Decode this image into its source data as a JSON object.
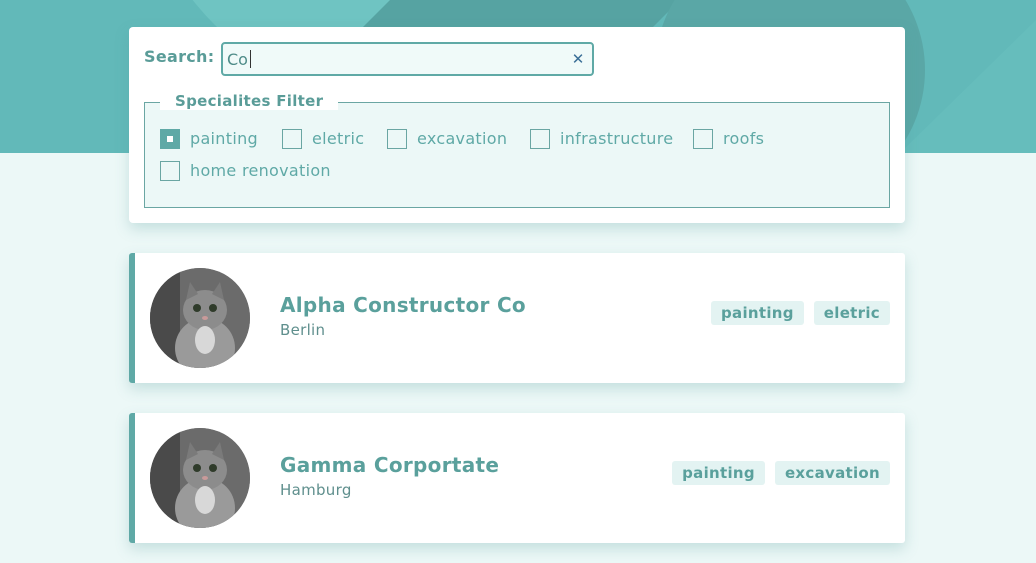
{
  "colors": {
    "accent": "#5fa9a6",
    "banner": "#62b9b9",
    "background": "#ecf8f7"
  },
  "search": {
    "label": "Search:",
    "value": "Co",
    "clear_icon": "close-icon"
  },
  "filter": {
    "legend": "Specialites Filter",
    "options": [
      {
        "label": "painting",
        "checked": true
      },
      {
        "label": "eletric",
        "checked": false
      },
      {
        "label": "excavation",
        "checked": false
      },
      {
        "label": "infrastructure",
        "checked": false
      },
      {
        "label": "roofs",
        "checked": false
      },
      {
        "label": "home renovation",
        "checked": false
      }
    ]
  },
  "results": [
    {
      "name": "Alpha Constructor Co",
      "city": "Berlin",
      "avatar": "kitten-photo",
      "tags": [
        "painting",
        "eletric"
      ]
    },
    {
      "name": "Gamma Corportate",
      "city": "Hamburg",
      "avatar": "kitten-photo",
      "tags": [
        "painting",
        "excavation"
      ]
    }
  ]
}
